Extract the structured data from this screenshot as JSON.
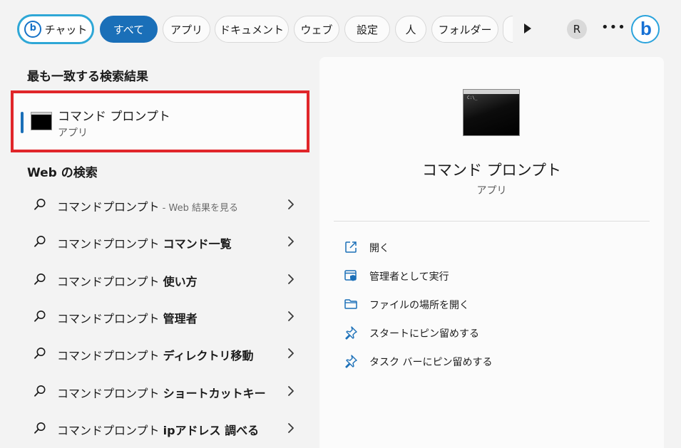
{
  "filters": {
    "chat": "チャット",
    "all": "すべて",
    "apps": "アプリ",
    "documents": "ドキュメント",
    "web": "ウェブ",
    "settings": "設定",
    "people": "人",
    "folders": "フォルダー",
    "avatar_initial": "R",
    "more": "•••"
  },
  "best_match": {
    "heading": "最も一致する検索結果",
    "title": "コマンド プロンプト",
    "subtitle": "アプリ",
    "icon": "command-prompt-icon"
  },
  "web_search": {
    "heading": "Web の検索",
    "items": [
      {
        "query": "コマンドプロンプト",
        "suffix": "",
        "note": " - Web 結果を見る"
      },
      {
        "query": "コマンドプロンプト ",
        "suffix": "コマンド一覧",
        "note": ""
      },
      {
        "query": "コマンドプロンプト ",
        "suffix": "使い方",
        "note": ""
      },
      {
        "query": "コマンドプロンプト ",
        "suffix": "管理者",
        "note": ""
      },
      {
        "query": "コマンドプロンプト ",
        "suffix": "ディレクトリ移動",
        "note": ""
      },
      {
        "query": "コマンドプロンプト ",
        "suffix": "ショートカットキー",
        "note": ""
      },
      {
        "query": "コマンドプロンプト ",
        "suffix": "ipアドレス 調べる",
        "note": ""
      }
    ]
  },
  "detail": {
    "title": "コマンド プロンプト",
    "subtitle": "アプリ",
    "actions": [
      {
        "label": "開く",
        "icon": "open-external-icon"
      },
      {
        "label": "管理者として実行",
        "icon": "shield-window-icon"
      },
      {
        "label": "ファイルの場所を開く",
        "icon": "folder-icon"
      },
      {
        "label": "スタートにピン留めする",
        "icon": "pin-icon"
      },
      {
        "label": "タスク バーにピン留めする",
        "icon": "pin-icon"
      }
    ]
  },
  "colors": {
    "accent": "#1a6fb8",
    "highlight_border": "#e0262a",
    "chat_border": "#2ea7d6"
  }
}
